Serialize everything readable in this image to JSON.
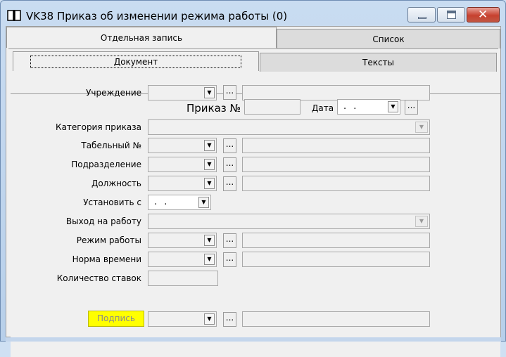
{
  "window": {
    "title": "VK38 Приказ об изменении режима работы (0)",
    "icon": "book-icon",
    "close_glyph": "✕"
  },
  "tabs_top": [
    "Отдельная запись",
    "Список"
  ],
  "tabs_inner": [
    "Документ",
    "Тексты"
  ],
  "form": {
    "institution_label": "Учреждение",
    "order_label": "Приказ №",
    "date_label": "Дата",
    "date_value": ". .",
    "category_label": "Категория приказа",
    "tab_number_label": "Табельный №",
    "department_label": "Подразделение",
    "position_label": "Должность",
    "set_from_label": "Установить с",
    "set_from_value": ". .",
    "return_label": "Выход на работу",
    "mode_label": "Режим работы",
    "norm_label": "Норма времени",
    "rate_count_label": "Количество ставок",
    "sign_button": "Подпись",
    "dots": "...",
    "arrow": "▼"
  },
  "colors": {
    "sign_button_bg": "#ffff00",
    "close_button": "#c7412f"
  }
}
